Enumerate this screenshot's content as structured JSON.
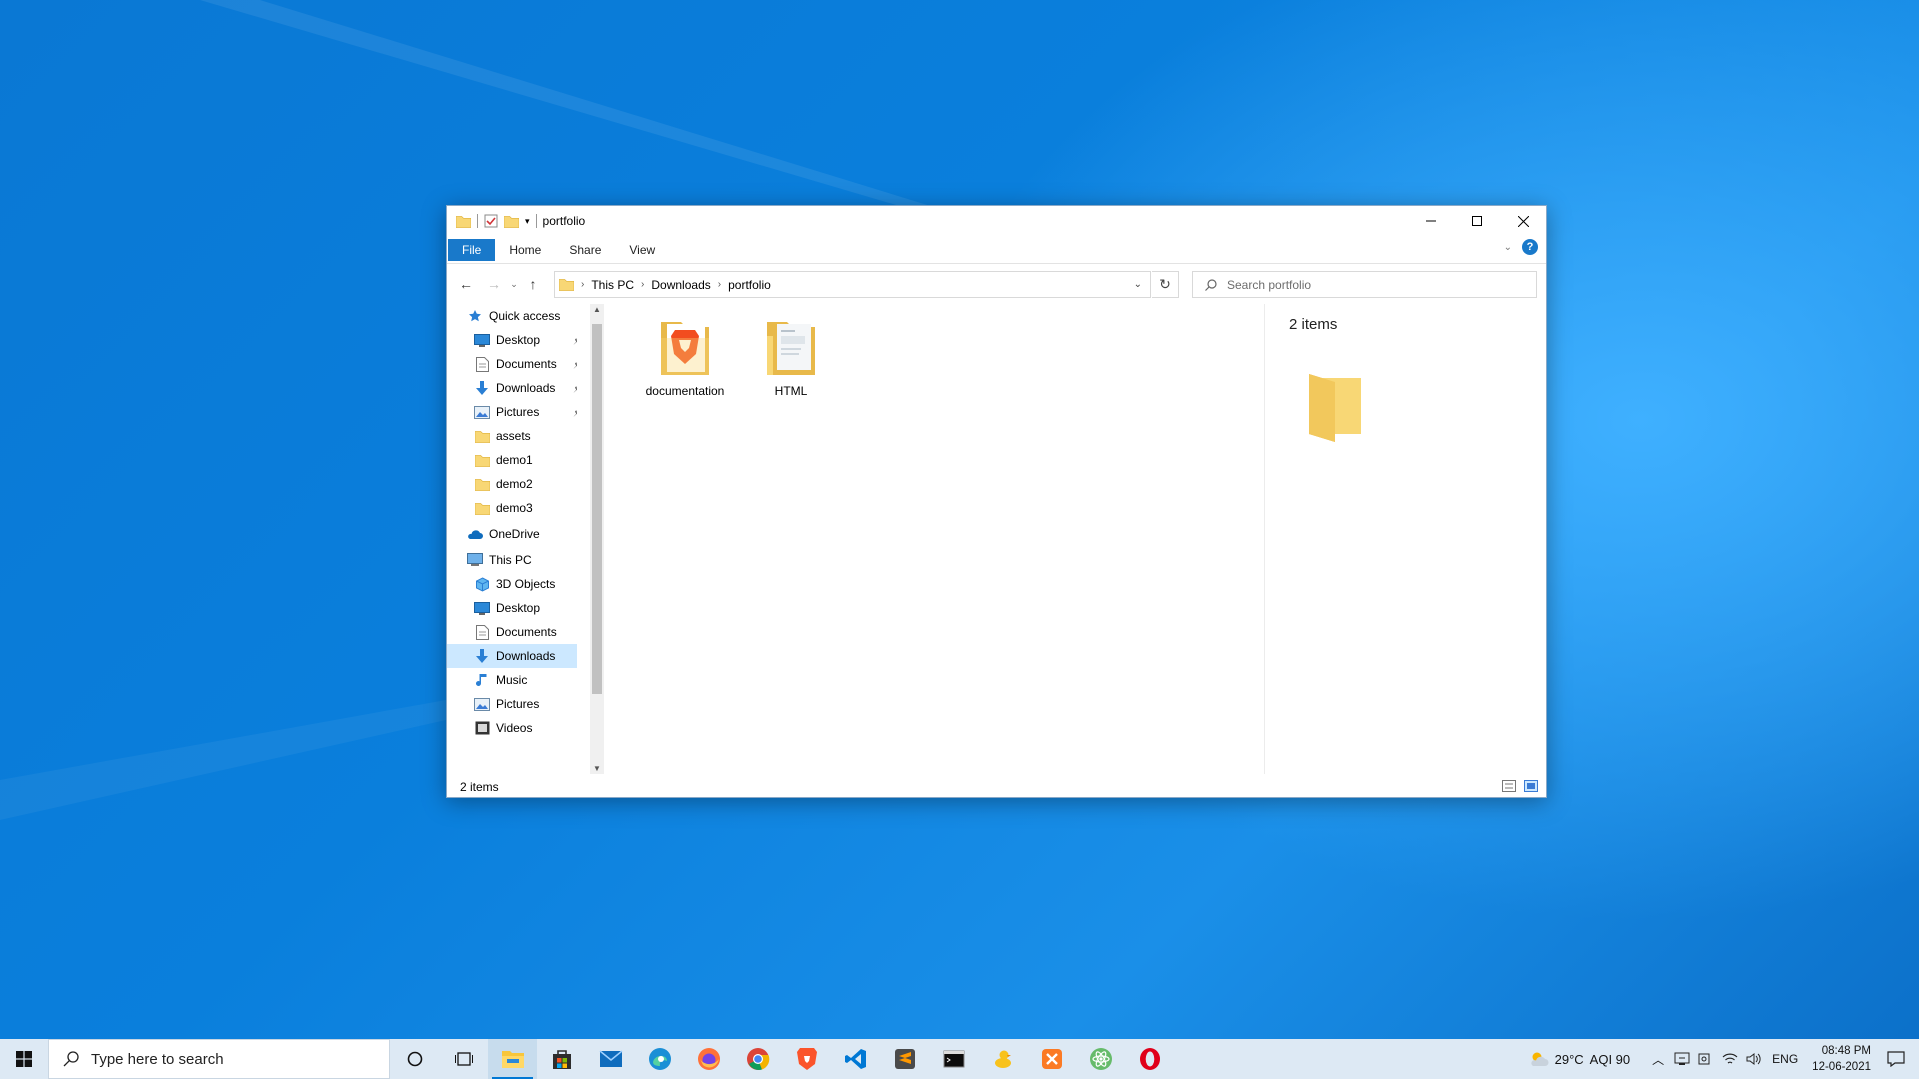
{
  "explorer": {
    "title": "portfolio",
    "ribbon_tabs": [
      "File",
      "Home",
      "Share",
      "View"
    ],
    "breadcrumb": [
      "This PC",
      "Downloads",
      "portfolio"
    ],
    "search_placeholder": "Search portfolio",
    "nav_items": [
      {
        "label": "Quick access",
        "icon": "star-icon",
        "level": 0,
        "pinned": false,
        "selected": false
      },
      {
        "label": "Desktop",
        "icon": "desktop-icon",
        "level": 1,
        "pinned": true,
        "selected": false
      },
      {
        "label": "Documents",
        "icon": "documents-icon",
        "level": 1,
        "pinned": true,
        "selected": false
      },
      {
        "label": "Downloads",
        "icon": "download-arrow-icon",
        "level": 1,
        "pinned": true,
        "selected": false
      },
      {
        "label": "Pictures",
        "icon": "pictures-icon",
        "level": 1,
        "pinned": true,
        "selected": false
      },
      {
        "label": "assets",
        "icon": "folder-icon",
        "level": 1,
        "pinned": false,
        "selected": false
      },
      {
        "label": "demo1",
        "icon": "folder-icon",
        "level": 1,
        "pinned": false,
        "selected": false
      },
      {
        "label": "demo2",
        "icon": "folder-icon",
        "level": 1,
        "pinned": false,
        "selected": false
      },
      {
        "label": "demo3",
        "icon": "folder-icon",
        "level": 1,
        "pinned": false,
        "selected": false
      },
      {
        "label": "OneDrive",
        "icon": "cloud-icon",
        "level": 0,
        "pinned": false,
        "selected": false
      },
      {
        "label": "This PC",
        "icon": "computer-icon",
        "level": 0,
        "pinned": false,
        "selected": false
      },
      {
        "label": "3D Objects",
        "icon": "cube-icon",
        "level": 1,
        "pinned": false,
        "selected": false
      },
      {
        "label": "Desktop",
        "icon": "desktop-icon",
        "level": 1,
        "pinned": false,
        "selected": false
      },
      {
        "label": "Documents",
        "icon": "documents-icon",
        "level": 1,
        "pinned": false,
        "selected": false
      },
      {
        "label": "Downloads",
        "icon": "download-arrow-icon",
        "level": 1,
        "pinned": false,
        "selected": true
      },
      {
        "label": "Music",
        "icon": "music-icon",
        "level": 1,
        "pinned": false,
        "selected": false
      },
      {
        "label": "Pictures",
        "icon": "pictures-icon",
        "level": 1,
        "pinned": false,
        "selected": false
      },
      {
        "label": "Videos",
        "icon": "video-icon",
        "level": 1,
        "pinned": false,
        "selected": false
      }
    ],
    "files": [
      {
        "name": "documentation",
        "icon": "brave-folder-icon"
      },
      {
        "name": "HTML",
        "icon": "document-folder-icon"
      }
    ],
    "preview_count": "2 items",
    "status_count": "2 items"
  },
  "taskbar": {
    "search_placeholder": "Type here to search",
    "apps": [
      "cortana-circle-icon",
      "task-view-icon",
      "file-explorer-icon",
      "store-icon",
      "mail-icon",
      "edge-icon",
      "firefox-icon",
      "chrome-icon",
      "brave-icon",
      "vscode-icon",
      "sublime-icon",
      "terminal-icon",
      "cyberduck-icon",
      "xampp-icon",
      "atom-icon",
      "opera-icon"
    ],
    "weather": "29°C",
    "aqi": "AQI 90",
    "language": "ENG",
    "time": "08:48 PM",
    "date": "12-06-2021"
  },
  "colors": {
    "accent": "#1979ca",
    "selected": "#cce8ff",
    "folder": "#f8d775",
    "taskbar": "#dde9f4"
  }
}
